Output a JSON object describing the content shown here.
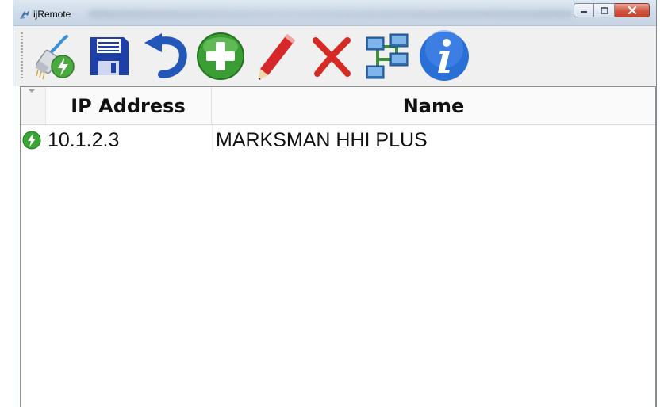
{
  "window": {
    "title": "ijRemote",
    "icon": "ijremote-app-icon",
    "caption_buttons": [
      "minimize",
      "maximize",
      "close"
    ]
  },
  "toolbar": {
    "buttons": [
      {
        "name": "connect",
        "icon": "network-cable-connect-icon"
      },
      {
        "name": "save",
        "icon": "floppy-disk-icon"
      },
      {
        "name": "undo",
        "icon": "undo-arrow-icon"
      },
      {
        "name": "add",
        "icon": "green-plus-icon"
      },
      {
        "name": "edit",
        "icon": "pencil-icon"
      },
      {
        "name": "delete",
        "icon": "red-x-icon"
      },
      {
        "name": "network",
        "icon": "network-topology-icon"
      },
      {
        "name": "about",
        "icon": "info-icon"
      }
    ]
  },
  "grid": {
    "columns": [
      "IP Address",
      "Name"
    ],
    "rows": [
      {
        "status": "connected-lightning-icon",
        "ip": "10.1.2.3",
        "name": "MARKSMAN HHI PLUS"
      }
    ]
  },
  "colors": {
    "titlebar": "#cfdbe9",
    "close_button": "#c4432e",
    "toolbar_bg": "#f0f0f0",
    "status_green": "#3aa535",
    "info_blue": "#2a6fd6"
  }
}
